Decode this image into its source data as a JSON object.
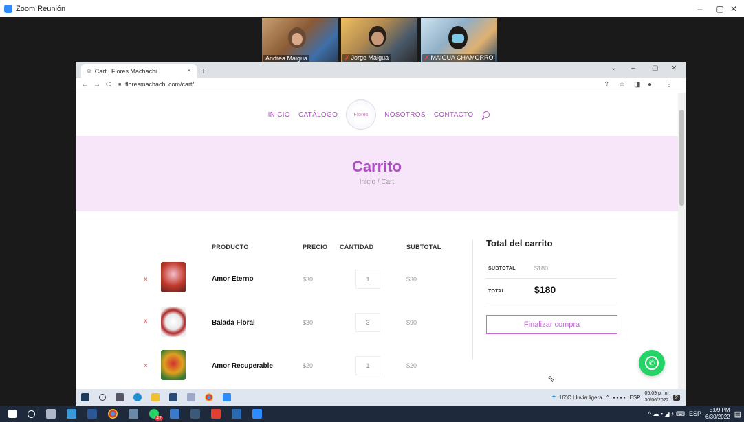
{
  "zoom": {
    "window_title": "Zoom Reunión",
    "controls": {
      "minimize": "–",
      "maximize": "▢",
      "close": "✕"
    }
  },
  "participants": [
    {
      "name": "Andrea Maigua"
    },
    {
      "name": "Jorge Maigua"
    },
    {
      "name": "MAIGUA CHAMORRO ..."
    }
  ],
  "browser": {
    "tab_title": "Cart | Flores Machachi",
    "tab_close": "×",
    "new_tab": "+",
    "url": "floresmachachi.com/cart/",
    "window_controls": {
      "dropdown": "⌄",
      "minimize": "–",
      "maximize": "▢",
      "close": "✕"
    },
    "nav_icons": {
      "back": "←",
      "forward": "→",
      "reload": "C",
      "lock": "🔒",
      "share": "⇪",
      "star": "☆",
      "sidebar": "◨",
      "profile": "👤",
      "menu": "⋮"
    }
  },
  "site": {
    "nav": {
      "inicio": "INICIO",
      "catalogo": "CATÁLOGO",
      "nosotros": "NOSOTROS",
      "contacto": "CONTACTO",
      "logo_text": "Flores"
    },
    "hero": {
      "title": "Carrito",
      "breadcrumb": "Inicio / Cart"
    },
    "cart": {
      "headers": {
        "producto": "PRODUCTO",
        "precio": "PRECIO",
        "cantidad": "CANTIDAD",
        "subtotal": "SUBTOTAL"
      },
      "remove_symbol": "×",
      "items": [
        {
          "name": "Amor Eterno",
          "price": "$30",
          "qty": "1",
          "subtotal": "$30",
          "thumb_color": "#c0392b"
        },
        {
          "name": "Balada Floral",
          "price": "$30",
          "qty": "3",
          "subtotal": "$90",
          "thumb_color": "#e8e8e8"
        },
        {
          "name": "Amor Recuperable",
          "price": "$20",
          "qty": "1",
          "subtotal": "$20",
          "thumb_color": "#e0a020"
        }
      ]
    },
    "totals": {
      "title": "Total del carrito",
      "subtotal_label": "SUBTOTAL",
      "subtotal_value": "$180",
      "total_label": "TOTAL",
      "total_value": "$180",
      "checkout_label": "Finalizar compra"
    },
    "accent_color": "#b04ec4",
    "whatsapp_icon": "whatsapp-icon"
  },
  "inner_taskbar": {
    "weather": "16°C  Lluvia ligera",
    "lang": "ESP",
    "time": "05:09 p. m.",
    "date": "30/06/2022",
    "notif_count": "2"
  },
  "taskbar": {
    "lang": "ESP",
    "time": "5:09 PM",
    "date": "6/30/2022",
    "badge": "42"
  }
}
